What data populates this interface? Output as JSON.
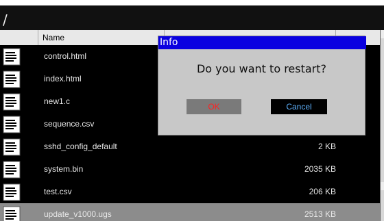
{
  "path": "/",
  "table": {
    "columns": [
      "",
      "Name",
      "",
      ""
    ],
    "rows": [
      {
        "name": "control.html",
        "size": ""
      },
      {
        "name": "index.html",
        "size": ""
      },
      {
        "name": "new1.c",
        "size": ""
      },
      {
        "name": "sequence.csv",
        "size": ""
      },
      {
        "name": "sshd_config_default",
        "size": "2 KB"
      },
      {
        "name": "system.bin",
        "size": "2035 KB"
      },
      {
        "name": "test.csv",
        "size": "206 KB"
      },
      {
        "name": "update_v1000.ugs",
        "size": "2513 KB"
      }
    ]
  },
  "dialog": {
    "title": "Info",
    "message": "Do you want to restart?",
    "ok_label": "OK",
    "cancel_label": "Cancel"
  },
  "colors": {
    "dialog_title_bg": "#0a00e0",
    "ok_text": "#ff2020",
    "cancel_text": "#5fb3ff",
    "selected_row": "#8c8c8c"
  }
}
